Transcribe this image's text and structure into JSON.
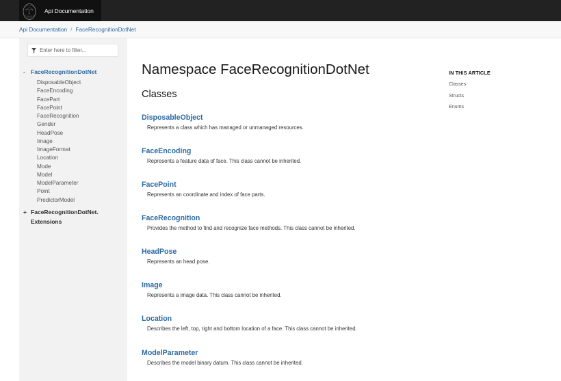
{
  "navbar": {
    "title": "Api Documentation"
  },
  "breadcrumb": [
    {
      "label": "Api Documentation"
    },
    {
      "label": "FaceRecognitionDotNet"
    }
  ],
  "breadcrumb_separator": "/",
  "filter": {
    "placeholder": "Enter here to filter..."
  },
  "toc": {
    "expanded": {
      "toggle": "-",
      "label": "FaceRecognitionDotNet",
      "children": [
        "DisposableObject",
        "FaceEncoding",
        "FacePart",
        "FacePoint",
        "FaceRecognition",
        "Gender",
        "HeadPose",
        "Image",
        "ImageFormat",
        "Location",
        "Mode",
        "Model",
        "ModelParameter",
        "Point",
        "PredictorModel"
      ]
    },
    "collapsed": {
      "toggle": "+",
      "label_line1": "FaceRecognitionDotNet.",
      "label_line2": "Extensions"
    }
  },
  "main": {
    "title": "Namespace FaceRecognitionDotNet",
    "section": "Classes",
    "classes": [
      {
        "name": "DisposableObject",
        "description": "Represents a class which has managed or unmanaged resources."
      },
      {
        "name": "FaceEncoding",
        "description": "Represents a feature data of face. This class cannot be inherited."
      },
      {
        "name": "FacePoint",
        "description": "Represents an coordinate and index of face parts."
      },
      {
        "name": "FaceRecognition",
        "description": "Provides the method to find and recognize face methods. This class cannot be inherited."
      },
      {
        "name": "HeadPose",
        "description": "Represents an head pose."
      },
      {
        "name": "Image",
        "description": "Represents a image data. This class cannot be inherited."
      },
      {
        "name": "Location",
        "description": "Describes the left, top, right and bottom location of a face. This class cannot be inherited."
      },
      {
        "name": "ModelParameter",
        "description": "Describes the model binary datum. This class cannot be inherited."
      }
    ]
  },
  "article_toc": {
    "heading": "IN THIS ARTICLE",
    "links": [
      "Classes",
      "Structs",
      "Enums"
    ]
  },
  "colors": {
    "link": "#2c6aa5",
    "navbar": "#222222",
    "brand_bg": "#111111",
    "sidebar_bg": "#f2f2f2"
  }
}
